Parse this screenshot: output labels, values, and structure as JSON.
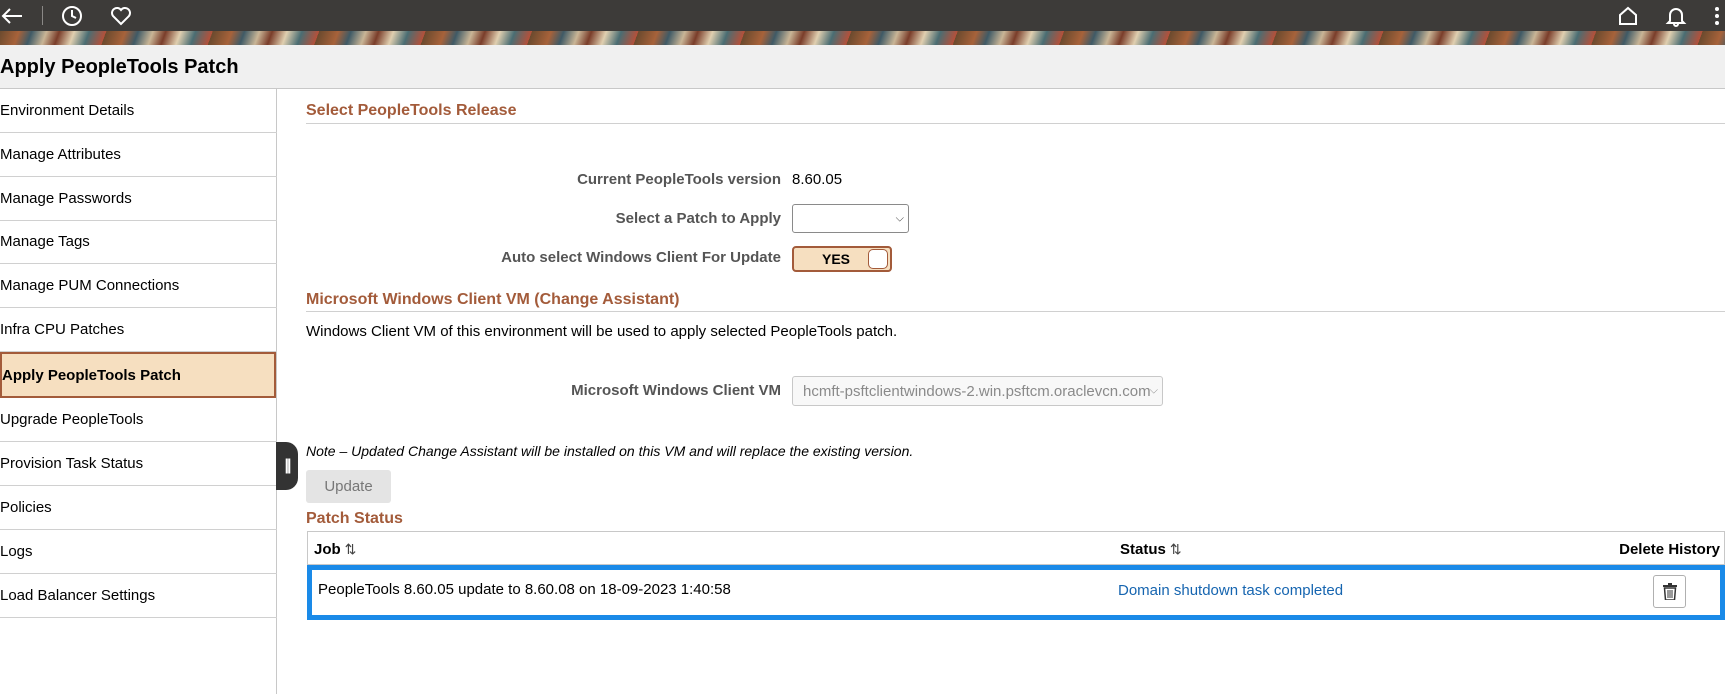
{
  "topbar": {
    "back_icon": "back-arrow-icon",
    "recent_icon": "clock-icon",
    "favorites_icon": "heart-icon",
    "home_icon": "home-icon",
    "notifications_icon": "bell-icon",
    "more_icon": "more-vertical-icon"
  },
  "page": {
    "title": "Apply PeopleTools Patch"
  },
  "sidebar": {
    "items": [
      {
        "label": "Environment Details"
      },
      {
        "label": "Manage Attributes"
      },
      {
        "label": "Manage Passwords"
      },
      {
        "label": "Manage Tags"
      },
      {
        "label": "Manage PUM Connections"
      },
      {
        "label": "Infra CPU Patches"
      },
      {
        "label": "Apply PeopleTools Patch",
        "active": true
      },
      {
        "label": "Upgrade PeopleTools"
      },
      {
        "label": "Provision Task Status"
      },
      {
        "label": "Policies"
      },
      {
        "label": "Logs"
      },
      {
        "label": "Load Balancer Settings"
      }
    ]
  },
  "release": {
    "section_title": "Select PeopleTools Release",
    "current_version_label": "Current PeopleTools version",
    "current_version_value": "8.60.05",
    "patch_label": "Select a Patch to Apply",
    "patch_value": "",
    "auto_select_label": "Auto select Windows Client For Update",
    "auto_select_value": "YES"
  },
  "client_vm": {
    "section_title": "Microsoft Windows Client VM (Change Assistant)",
    "description": "Windows Client VM of this environment will be used to apply selected PeopleTools patch.",
    "vm_label": "Microsoft Windows Client VM",
    "vm_value": "hcmft-psftclientwindows-2.win.psftcm.oraclevcn.com",
    "note": "Note – Updated Change Assistant will be installed on this VM and will replace the existing version.",
    "update_button": "Update"
  },
  "patch_status": {
    "section_title": "Patch Status",
    "columns": {
      "job": "Job",
      "status": "Status",
      "delete": "Delete History"
    },
    "sort_icon": "sort-arrows-icon",
    "rows": [
      {
        "job": "PeopleTools 8.60.05 update to 8.60.08 on 18-09-2023 1:40:58",
        "status": "Domain shutdown task completed",
        "delete_icon": "trash-icon"
      }
    ]
  },
  "colors": {
    "accent": "#a35b3a",
    "active_bg": "#f6dfc0",
    "highlight_border": "#1a8ae8",
    "link": "#1665b0",
    "topbar": "#3d3b39"
  }
}
